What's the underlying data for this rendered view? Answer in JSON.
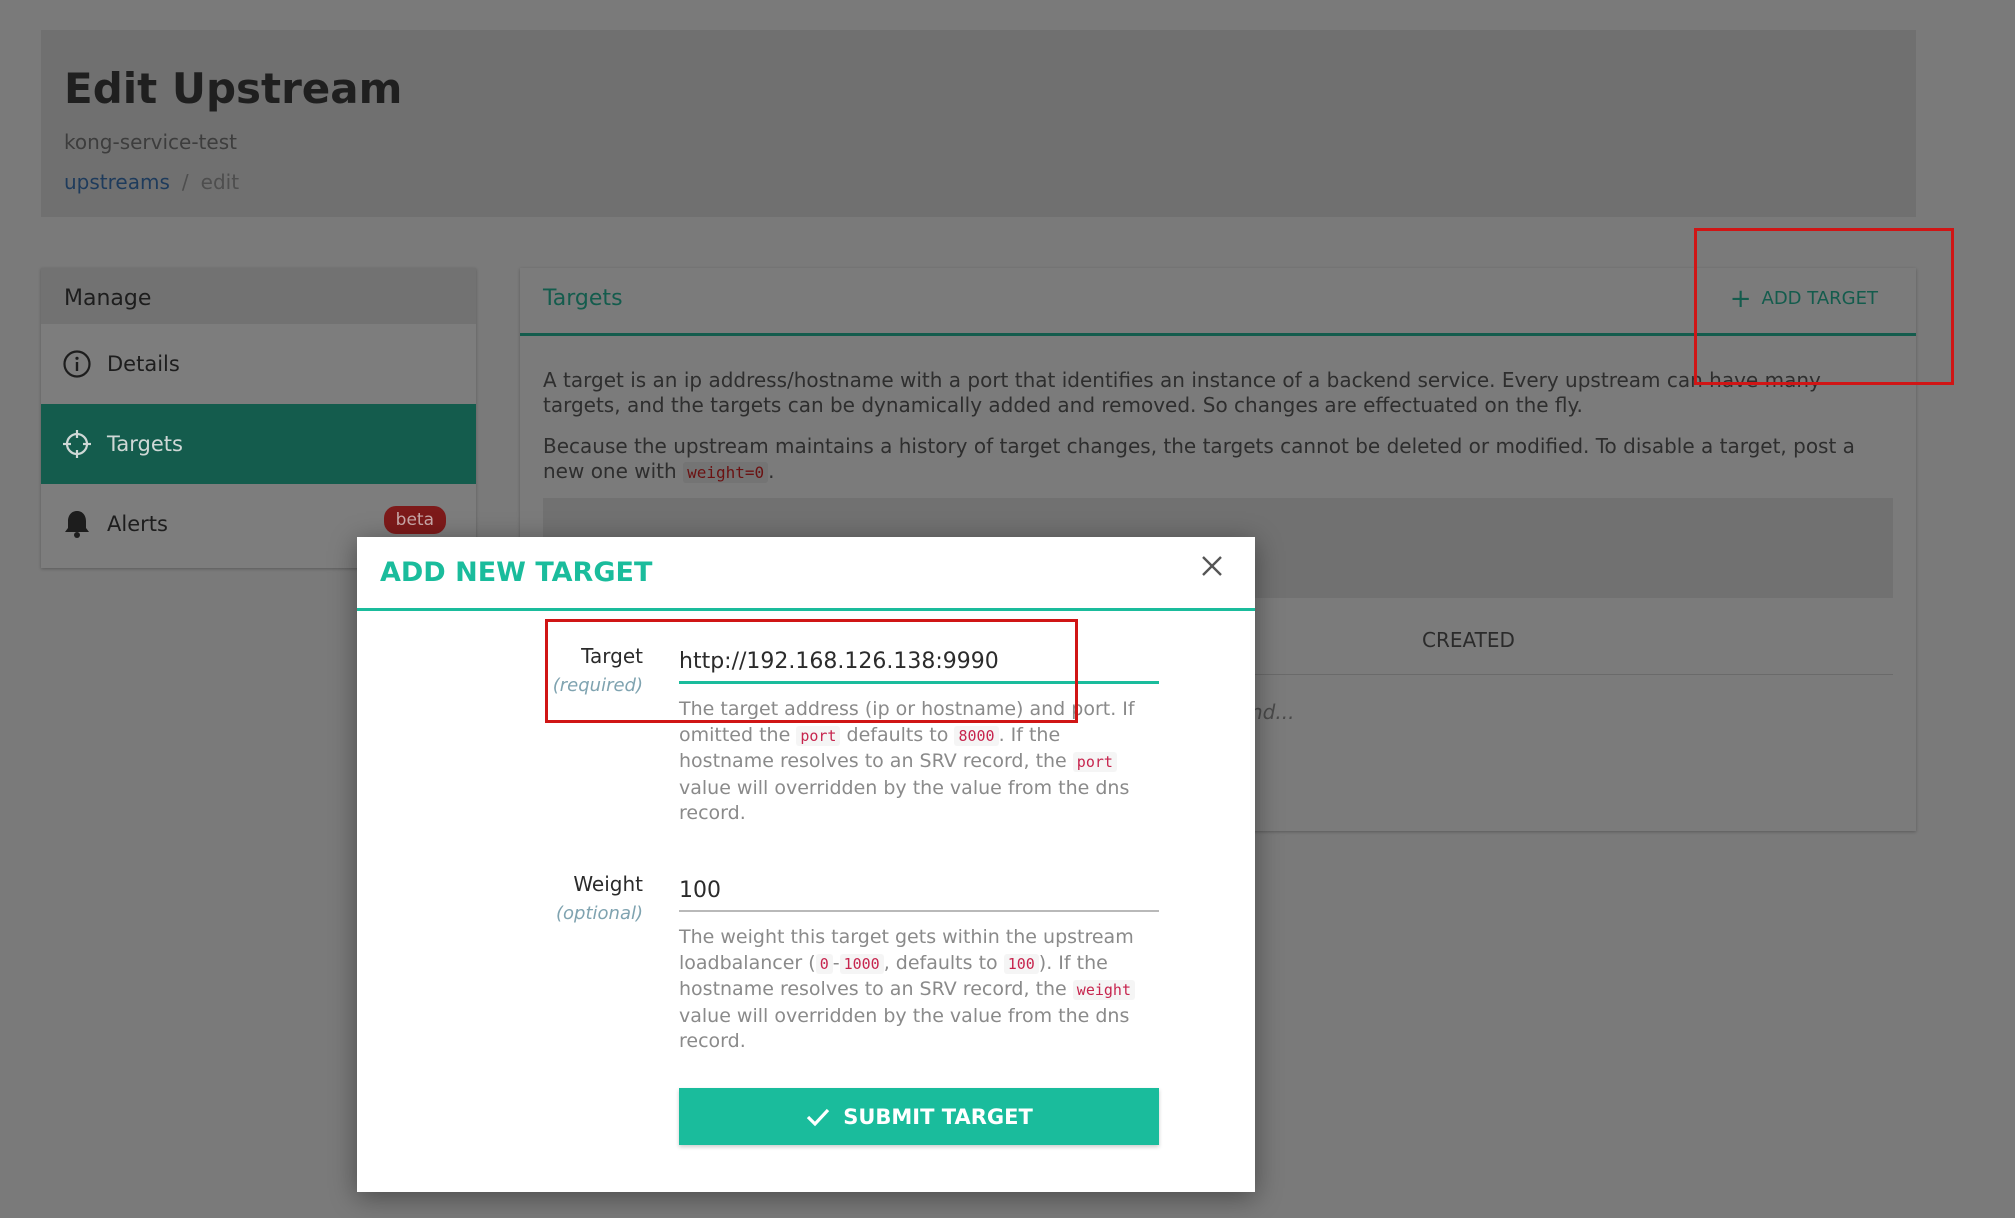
{
  "header": {
    "title": "Edit Upstream",
    "subtitle": "kong-service-test",
    "breadcrumb": {
      "link": "upstreams",
      "separator": "/",
      "current": "edit"
    }
  },
  "sidebar": {
    "heading": "Manage",
    "items": [
      {
        "label": "Details",
        "icon": "info-icon"
      },
      {
        "label": "Targets",
        "icon": "crosshair-icon"
      },
      {
        "label": "Alerts",
        "icon": "bell-icon",
        "badge": "beta"
      }
    ]
  },
  "main": {
    "title": "Targets",
    "add_button": "ADD TARGET",
    "description": {
      "p1": "A target is an ip address/hostname with a port that identifies an instance of a backend service. Every upstream can have many targets, and the targets can be dynamically added and removed. So changes are effectuated on the fly.",
      "p2_text": "Because the upstream maintains a history of target changes, the targets cannot be deleted or modified. To disable a target, post a new one with",
      "p2_code": "weight=0",
      "p2_end": "."
    },
    "table": {
      "col_created": "CREATED",
      "loading": "nd..."
    }
  },
  "modal": {
    "title": "ADD NEW TARGET",
    "target": {
      "label": "Target",
      "hint": "(required)",
      "value": "http://192.168.126.138:9990",
      "help": {
        "t1": "The target address (ip or hostname) and port. If omitted the",
        "c1": "port",
        "t2": "defaults to",
        "c2": "8000",
        "t3": ". If the hostname resolves to an SRV record, the",
        "c3": "port",
        "t4": "value will overridden by the value from the dns record."
      }
    },
    "weight": {
      "label": "Weight",
      "hint": "(optional)",
      "value": "100",
      "help": {
        "t1": "The weight this target gets within the upstream loadbalancer (",
        "c1": "0",
        "t2": "-",
        "c2": "1000",
        "t3": ", defaults to",
        "c3": "100",
        "t4": "). If the hostname resolves to an SRV record, the",
        "c4": "weight",
        "t5": "value will overridden by the value from the dns record."
      }
    },
    "submit": "SUBMIT TARGET"
  },
  "colors": {
    "accent": "#1abc9c",
    "highlight": "#d01515",
    "badge": "#c0392b"
  }
}
